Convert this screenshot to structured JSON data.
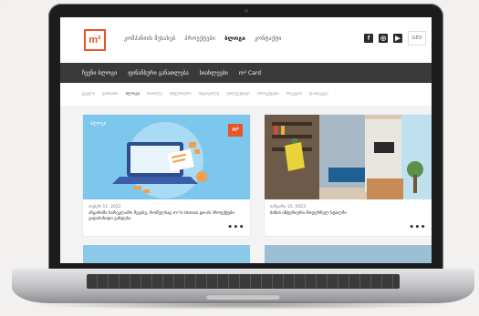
{
  "site": {
    "logo": "m²",
    "top_nav": [
      "კომპანიის შესახებ",
      "პროექტები",
      "ბლოგი",
      "კონტაქტი"
    ],
    "socials": [
      "f",
      "◎",
      "▶"
    ],
    "lang": "GEO",
    "sub_nav": [
      "ჩვენი ბლოგი",
      "ფინანსური განათლება",
      "სიახლეები",
      "m² Card"
    ],
    "filters": [
      "ყველა",
      "დიზაინი",
      "ბლოგი",
      "სიახლე",
      "ინტერიერი",
      "სიცოცხლე",
      "ქოლექტივი",
      "პროექტები",
      "რჩევები",
      "დაზღვევა"
    ],
    "cards": [
      {
        "tag": "ბლოგი",
        "logo": "m²",
        "date": "თებერ 11, 2022",
        "title": "ანგარიში სარეკლამო შევასე, რომელსაც m²-ს Homes.ge-ის პროექტები გადასახადი გახდება",
        "more": "•••"
      },
      {
        "date": "იანვარი 15, 2023",
        "title": "ბინის ინტერიერი მოდერნულ სტილში",
        "more": "•••"
      }
    ]
  }
}
